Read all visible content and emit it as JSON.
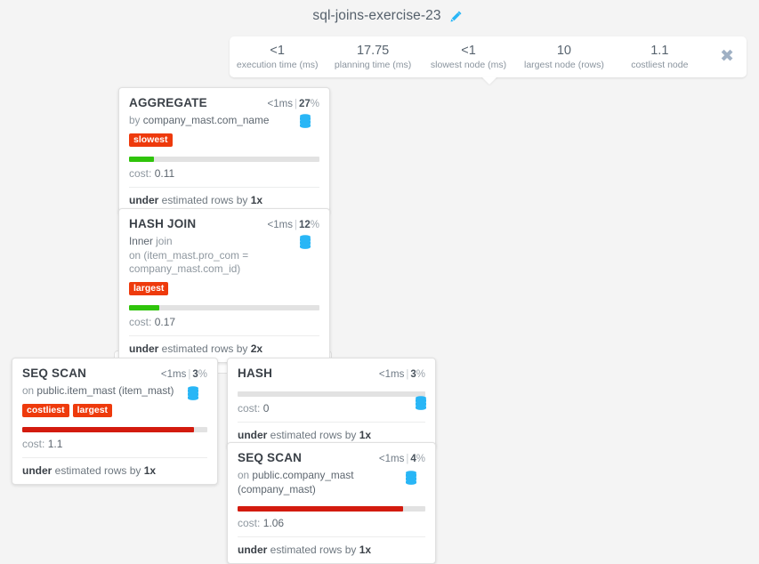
{
  "header": {
    "title": "sql-joins-exercise-23",
    "edit_icon": "pencil-icon",
    "edit_color": "#29b6f6"
  },
  "stats": {
    "close_label": "✖",
    "items": [
      {
        "value": "<1",
        "label": "execution time (ms)"
      },
      {
        "value": "17.75",
        "label": "planning time (ms)"
      },
      {
        "value": "<1",
        "label": "slowest node (ms)"
      },
      {
        "value": "10",
        "label": "largest node (rows)"
      },
      {
        "value": "1.1",
        "label": "costliest node"
      }
    ]
  },
  "colors": {
    "badge": "#ee3a0c",
    "bar_green": "#2fc40a",
    "bar_red": "#d31b0e",
    "bar_track": "#e2e2e2",
    "db_icon": "#29b6f6",
    "connector": "#c9c9c9"
  },
  "nodes": [
    {
      "id": "aggregate",
      "type": "AGGREGATE",
      "time": "<1ms",
      "separator": "|",
      "percent": "27",
      "percent_sign": "%",
      "subtitle_prefix": "by ",
      "subtitle_main": "company_mast.com_name",
      "db_icon": "database-icon",
      "badges": [
        "slowest"
      ],
      "bar_percent": 13,
      "bar_color": "#2fc40a",
      "cost_label": "cost: ",
      "cost_value": "0.11",
      "est_prefix": "under",
      "est_middle": " estimated rows by ",
      "est_factor": "1x"
    },
    {
      "id": "hash-join",
      "type": "HASH JOIN",
      "time": "<1ms",
      "separator": "|",
      "percent": "12",
      "percent_sign": "%",
      "subtitle_prefix": "Inner ",
      "subtitle_main": "join",
      "subtitle_line2": "on (item_mast.pro_com = company_mast.com_id)",
      "db_icon": "database-icon",
      "badges": [
        "largest"
      ],
      "bar_percent": 16,
      "bar_color": "#2fc40a",
      "cost_label": "cost: ",
      "cost_value": "0.17",
      "est_prefix": "under",
      "est_middle": " estimated rows by ",
      "est_factor": "2x"
    },
    {
      "id": "seq-scan-item-mast",
      "type": "SEQ SCAN",
      "time": "<1ms",
      "separator": "|",
      "percent": "3",
      "percent_sign": "%",
      "subtitle_prefix": "on ",
      "subtitle_main": "public.item_mast (item_mast)",
      "db_icon": "database-icon",
      "badges": [
        "costliest",
        "largest"
      ],
      "bar_percent": 93,
      "bar_color": "#d31b0e",
      "cost_label": "cost: ",
      "cost_value": "1.1",
      "est_prefix": "under",
      "est_middle": " estimated rows by ",
      "est_factor": "1x"
    },
    {
      "id": "hash",
      "type": "HASH",
      "time": "<1ms",
      "separator": "|",
      "percent": "3",
      "percent_sign": "%",
      "db_icon": "database-icon",
      "badges": [],
      "bar_percent": 0,
      "bar_color": "#2fc40a",
      "cost_label": "cost: ",
      "cost_value": "0",
      "est_prefix": "under",
      "est_middle": " estimated rows by ",
      "est_factor": "1x"
    },
    {
      "id": "seq-scan-company-mast",
      "type": "SEQ SCAN",
      "time": "<1ms",
      "separator": "|",
      "percent": "4",
      "percent_sign": "%",
      "subtitle_prefix": "on ",
      "subtitle_main": "public.company_mast (company_mast)",
      "db_icon": "database-icon",
      "badges": [],
      "bar_percent": 88,
      "bar_color": "#d31b0e",
      "cost_label": "cost: ",
      "cost_value": "1.06",
      "est_prefix": "under",
      "est_middle": " estimated rows by ",
      "est_factor": "1x"
    }
  ]
}
